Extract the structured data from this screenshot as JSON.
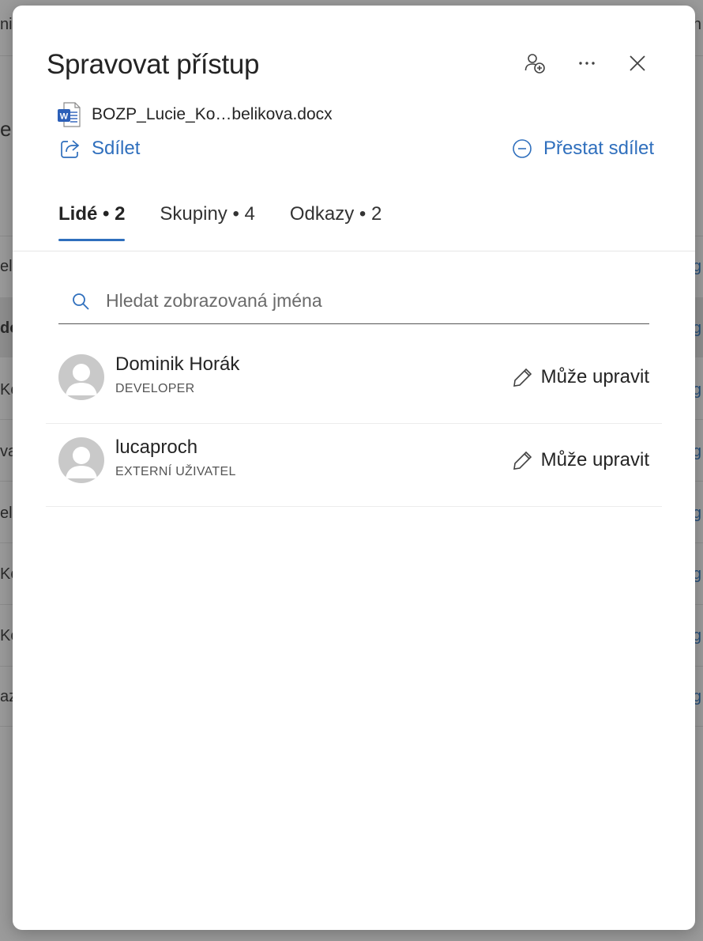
{
  "background": {
    "left_fragments": [
      "ni",
      "e",
      "eli",
      "do",
      "Ko",
      "va",
      "el",
      "Ko",
      "Ko",
      "az"
    ],
    "right_fragments": [
      "n",
      "g",
      "g",
      "g",
      "g",
      "g",
      "g",
      "g",
      "g"
    ]
  },
  "dialog": {
    "title": "Spravovat přístup",
    "header_icons": [
      "add-person-icon",
      "more-icon",
      "close-icon"
    ],
    "file": {
      "name": "BOZP_Lucie_Ko…belikova.docx",
      "icon": "word-document-icon",
      "icon_letter": "W"
    },
    "share_label": "Sdílet",
    "stop_sharing_label": "Přestat sdílet",
    "tabs": [
      {
        "label": "Lidé • 2",
        "active": true
      },
      {
        "label": "Skupiny • 4",
        "active": false
      },
      {
        "label": "Odkazy • 2",
        "active": false
      }
    ],
    "search": {
      "placeholder": "Hledat zobrazovaná jména",
      "value": ""
    },
    "people": [
      {
        "name": "Dominik Horák",
        "role": "DEVELOPER",
        "permission": "Může upravit"
      },
      {
        "name": "lucaproch",
        "role": "EXTERNÍ UŽIVATEL",
        "permission": "Může upravit"
      }
    ],
    "colors": {
      "accent": "#2f6fbd",
      "word_blue": "#2b5fb8"
    }
  }
}
